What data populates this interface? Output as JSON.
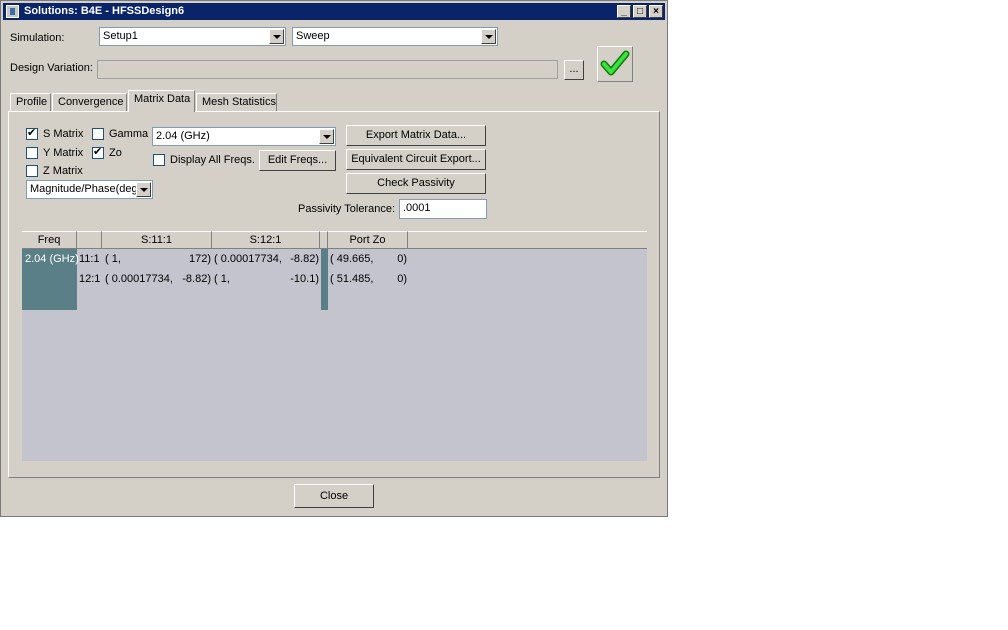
{
  "window": {
    "title": "Solutions: B4E - HFSSDesign6"
  },
  "simulation": {
    "label": "Simulation:",
    "setup": "Setup1",
    "sweep": "Sweep"
  },
  "design_variation": {
    "label": "Design Variation:",
    "value": "",
    "browse_label": "..."
  },
  "tabs": [
    {
      "label": "Profile"
    },
    {
      "label": "Convergence"
    },
    {
      "label": "Matrix Data"
    },
    {
      "label": "Mesh Statistics"
    }
  ],
  "matrix": {
    "s_matrix": {
      "label": "S Matrix",
      "checked": true
    },
    "gamma": {
      "label": "Gamma",
      "checked": false
    },
    "y_matrix": {
      "label": "Y Matrix",
      "checked": false
    },
    "zo": {
      "label": "Zo",
      "checked": true
    },
    "z_matrix": {
      "label": "Z Matrix",
      "checked": false
    },
    "format": "Magnitude/Phase(deg",
    "frequency": "2.04 (GHz)",
    "display_all": {
      "label": "Display All Freqs.",
      "checked": false
    },
    "edit_freqs_label": "Edit Freqs...",
    "export_label": "Export Matrix Data...",
    "equiv_label": "Equivalent Circuit Export...",
    "passivity_label": "Check Passivity",
    "tolerance_label": "Passivity Tolerance:",
    "tolerance_value": ".0001"
  },
  "table": {
    "headers": {
      "freq": "Freq",
      "s11": "S:11:1",
      "s12": "S:12:1",
      "portzo": "Port Zo"
    },
    "freq": "2.04 (GHz)",
    "rows": [
      {
        "port": "11:1",
        "s11_mag": "( 1,",
        "s11_ph": "172)",
        "s12_mag": "( 0.00017734,",
        "s12_ph": "-8.82)",
        "zo_mag": "( 49.665,",
        "zo_ph": "0)"
      },
      {
        "port": "12:1",
        "s11_mag": "( 0.00017734,",
        "s11_ph": "-8.82)",
        "s12_mag": "( 1,",
        "s12_ph": "-10.1)",
        "zo_mag": "( 51.485,",
        "zo_ph": "0)"
      }
    ]
  },
  "close_label": "Close",
  "colors": {
    "title_bg": "#0a246a",
    "dialog_bg": "#d4d0c8",
    "grid_bg": "#c4c4cf",
    "fixed_col": "#5a7f86"
  }
}
